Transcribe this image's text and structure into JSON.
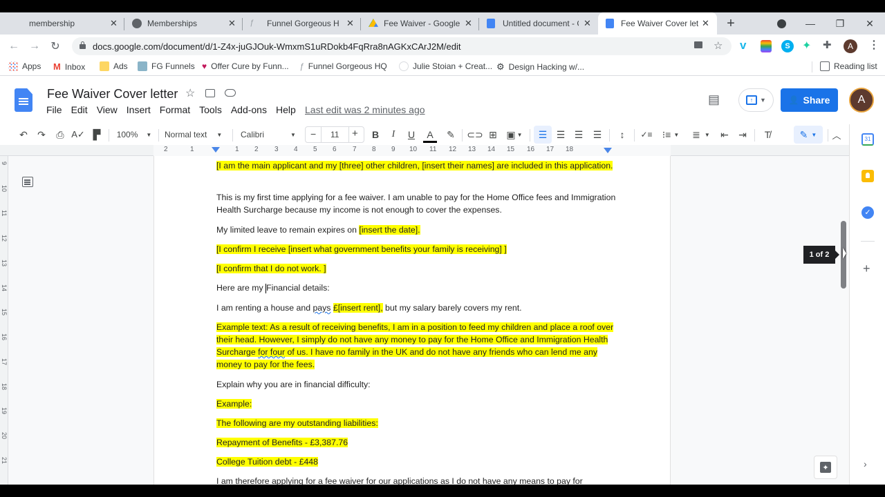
{
  "browser": {
    "tabs": [
      {
        "title": "membership",
        "icon": "none",
        "active": false
      },
      {
        "title": "Memberships",
        "icon": "globe-icon",
        "active": false
      },
      {
        "title": "Funnel Gorgeous HQ",
        "icon": "funnel-gorgeous-icon",
        "active": false
      },
      {
        "title": "Fee Waiver - Google D",
        "icon": "google-drive-icon",
        "active": false
      },
      {
        "title": "Untitled document - G",
        "icon": "google-docs-icon",
        "active": false
      },
      {
        "title": "Fee Waiver Cover lette",
        "icon": "google-docs-icon",
        "active": true
      }
    ],
    "new_tab_label": "+",
    "url": "docs.google.com/document/d/1-Z4x-juGJOuk-WmxmS1uRDokb4FqRra8nAGKxCArJ2M/edit",
    "profile_initial": "A",
    "bookmarks": [
      {
        "label": "Apps",
        "icon": "apps-grid-icon"
      },
      {
        "label": "Inbox",
        "icon": "gmail-icon"
      },
      {
        "label": "Ads",
        "icon": "folder-icon"
      },
      {
        "label": "FG Funnels",
        "icon": "fg-funnels-icon"
      },
      {
        "label": "Offer Cure by Funn...",
        "icon": "offer-cure-icon"
      },
      {
        "label": "Funnel Gorgeous HQ",
        "icon": "funnel-gorgeous-icon"
      },
      {
        "label": "Julie Stoian + Creat...",
        "icon": "julie-stoian-icon"
      },
      {
        "label": "Design Hacking w/...",
        "icon": "gear-icon"
      }
    ],
    "reading_list_label": "Reading list"
  },
  "docs": {
    "title": "Fee Waiver Cover letter",
    "menu": [
      "File",
      "Edit",
      "View",
      "Insert",
      "Format",
      "Tools",
      "Add-ons",
      "Help"
    ],
    "last_edit": "Last edit was 2 minutes ago",
    "share_label": "Share",
    "user_initial": "A",
    "toolbar": {
      "zoom": "100%",
      "style": "Normal text",
      "font": "Calibri",
      "font_size": "11",
      "minus": "−",
      "plus": "+"
    },
    "ruler_h": [
      "2",
      "1",
      "1",
      "2",
      "3",
      "4",
      "5",
      "6",
      "7",
      "8",
      "9",
      "10",
      "11",
      "12",
      "13",
      "14",
      "15",
      "16",
      "17",
      "18"
    ],
    "ruler_v": [
      "9",
      "10",
      "11",
      "12",
      "13",
      "14",
      "15",
      "16",
      "17",
      "18",
      "19",
      "20",
      "21"
    ],
    "page_indicator": "1 of 2",
    "body": {
      "p1": "[I am the main applicant and my [three] other children, [insert their names] are included in this application.",
      "p2": "This is my first time applying for a fee waiver. I am unable to pay for the Home Office fees and Immigration Health Surcharge because my income is not enough to cover the expenses.",
      "p3_a": "My limited leave to remain expires on ",
      "p3_b": "[insert the date].",
      "p4": "[I confirm I receive [insert what government benefits your family is receiving] ]",
      "p5": "[I confirm that I do not work. ]",
      "p6_a": "Here are my ",
      "p6_b": "Financial details:",
      "p7_a": "I am renting a house and ",
      "p7_b": "pays",
      "p7_c": " ",
      "p7_d": "£[insert rent],",
      "p7_e": " but my salary barely covers my rent.",
      "p8_a": "Example text:  As a result of receiving benefits, I am in a position to feed my children and place a roof over their head. However, I simply do not have any money to pay for the Home Office and Immigration Health Surcharge ",
      "p8_b": "for four",
      "p8_c": " of us. I have no family in the UK and do not have any friends who can lend me any money to pay for the fees.",
      "p9": "Explain why you are in financial difficulty:",
      "p10": "Example:",
      "p11": "The following are my outstanding liabilities:",
      "p12": "Repayment of Benefits - £3,387.76",
      "p13": "College Tuition debt - £448",
      "p14": "I am therefore applying for a fee waiver for our applications as I do not have any means to pay for"
    }
  },
  "colors": {
    "accent": "#1a73e8",
    "highlight": "#ffff00"
  }
}
